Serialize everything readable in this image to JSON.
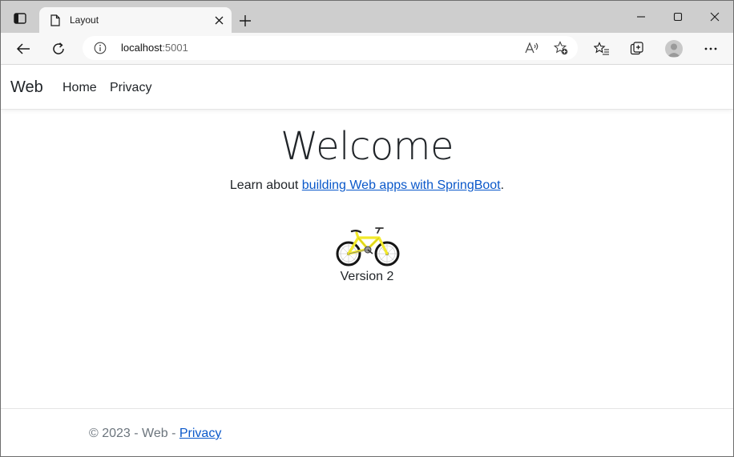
{
  "browser": {
    "tab_title": "Layout",
    "url_host": "localhost",
    "url_port": ":5001"
  },
  "navbar": {
    "brand": "Web",
    "links": [
      "Home",
      "Privacy"
    ]
  },
  "main": {
    "heading": "Welcome",
    "learn_prefix": "Learn about ",
    "learn_link": "building Web apps with SpringBoot",
    "learn_suffix": ".",
    "image_icon": "bicycle-icon",
    "version": "Version 2"
  },
  "footer": {
    "copyright": "© 2023 - Web - ",
    "privacy_link": "Privacy"
  },
  "colors": {
    "link": "#0a58ca",
    "tab_strip": "#cecece",
    "toolbar": "#f7f7f7",
    "bike_frame": "#f2e92a"
  }
}
